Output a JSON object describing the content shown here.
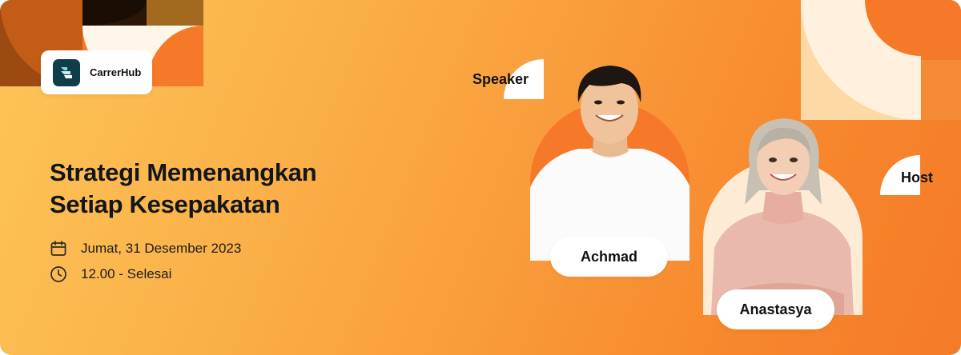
{
  "brand": {
    "name": "CarrerHub"
  },
  "event": {
    "title_line1": "Strategi Memenangkan",
    "title_line2": "Setiap Kesepakatan",
    "date": "Jumat, 31 Desember 2023",
    "time": "12.00 - Selesai"
  },
  "speaker": {
    "role_label": "Speaker",
    "name": "Achmad"
  },
  "host": {
    "role_label": "Host",
    "name": "Anastasya"
  },
  "icons": {
    "logo": "carrerhub-logo-icon",
    "date": "calendar-icon",
    "time": "clock-icon"
  },
  "colors": {
    "brand_dark": "#0f3d4a",
    "accent_orange": "#f6792a",
    "cream": "#fdebd6",
    "brown": "#9c4a12"
  }
}
